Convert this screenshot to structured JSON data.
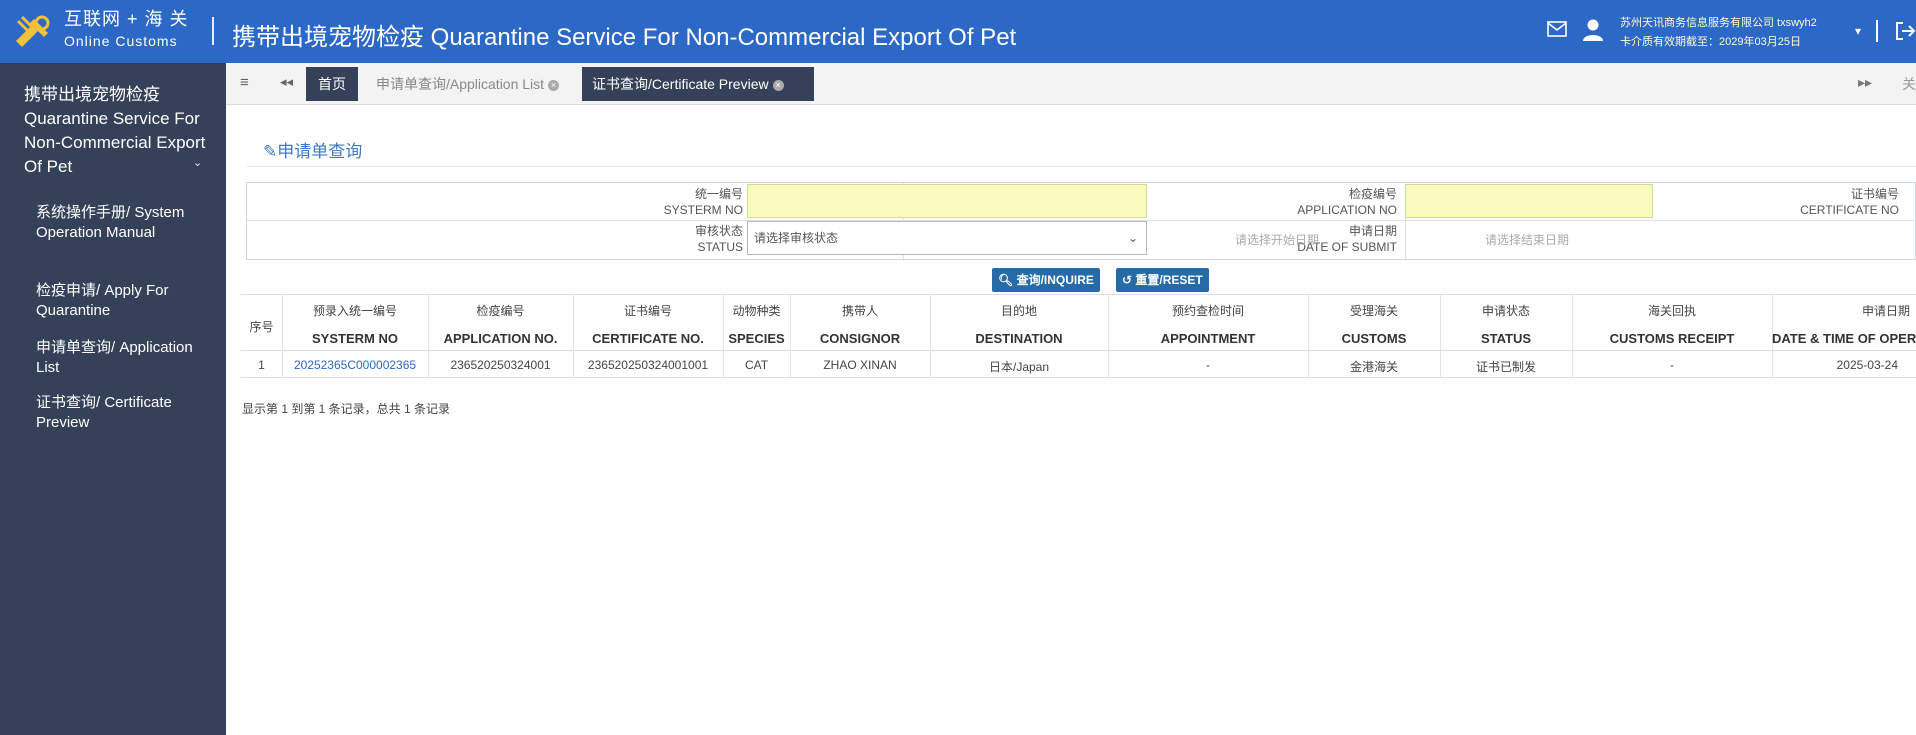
{
  "header": {
    "logo_line1": "互联网 + 海 关",
    "logo_line2": "Online Customs",
    "title": "携带出境宠物检疫 Quarantine Service For Non-Commercial Export Of Pet",
    "company": "苏州天讯商务信息服务有限公司 txswyh2",
    "expiry": "卡介质有效期截至：2029年03月25日",
    "caret": "▾"
  },
  "sidebar": {
    "group_title": "携带出境宠物检疫 Quarantine Service For Non-Commercial Export Of Pet",
    "items": [
      {
        "label": "系统操作手册/ System Operation Manual"
      },
      {
        "label": "检疫申请/ Apply For Quarantine"
      },
      {
        "label": "申请单查询/ Application List"
      },
      {
        "label": "证书查询/ Certificate Preview"
      }
    ]
  },
  "tabs": {
    "home": "首页",
    "application_list": "申请单查询/Application List",
    "certificate_preview": "证书查询/Certificate Preview",
    "right_text": "关"
  },
  "page": {
    "heading": "申请单查询"
  },
  "form": {
    "systerm_no_cn": "统一编号",
    "systerm_no_en": "SYSTERM NO",
    "application_no_cn": "检疫编号",
    "application_no_en": "APPLICATION NO",
    "certificate_no_cn": "证书编号",
    "certificate_no_en": "CERTIFICATE NO",
    "status_cn": "审核状态",
    "status_en": "STATUS",
    "status_placeholder": "请选择审核状态",
    "date_cn": "申请日期",
    "date_en": "DATE OF SUBMIT",
    "start_date_placeholder": "请选择开始日期",
    "end_date_placeholder": "请选择结束日期"
  },
  "buttons": {
    "inquire": "查询/INQUIRE",
    "reset": "重置/RESET"
  },
  "table": {
    "columns": [
      {
        "cn": "序号",
        "en": ""
      },
      {
        "cn": "预录入统一编号",
        "en": "SYSTERM NO"
      },
      {
        "cn": "检疫编号",
        "en": "APPLICATION NO."
      },
      {
        "cn": "证书编号",
        "en": "CERTIFICATE NO."
      },
      {
        "cn": "动物种类",
        "en": "SPECIES"
      },
      {
        "cn": "携带人",
        "en": "CONSIGNOR"
      },
      {
        "cn": "目的地",
        "en": "DESTINATION"
      },
      {
        "cn": "预约查检时间",
        "en": "APPOINTMENT"
      },
      {
        "cn": "受理海关",
        "en": "CUSTOMS"
      },
      {
        "cn": "申请状态",
        "en": "STATUS"
      },
      {
        "cn": "海关回执",
        "en": "CUSTOMS RECEIPT"
      },
      {
        "cn": "申请日期",
        "en": "DATE & TIME OF OPER"
      }
    ],
    "rows": [
      {
        "index": "1",
        "systerm_no": "20252365C000002365",
        "application_no": "236520250324001",
        "certificate_no": "236520250324001001",
        "species": "CAT",
        "consignor": "ZHAO XINAN",
        "destination": "日本/Japan",
        "appointment": "-",
        "customs": "金港海关",
        "status": "证书已制发",
        "customs_receipt": "-",
        "date": "2025-03-24"
      }
    ]
  },
  "footer_note": "显示第 1 到第 1 条记录，总共 1 条记录",
  "colors": {
    "header_blue": "#2c68c6",
    "sidebar_dark": "#344158",
    "button_blue": "#266aa8",
    "input_yellow": "#fafabf"
  }
}
